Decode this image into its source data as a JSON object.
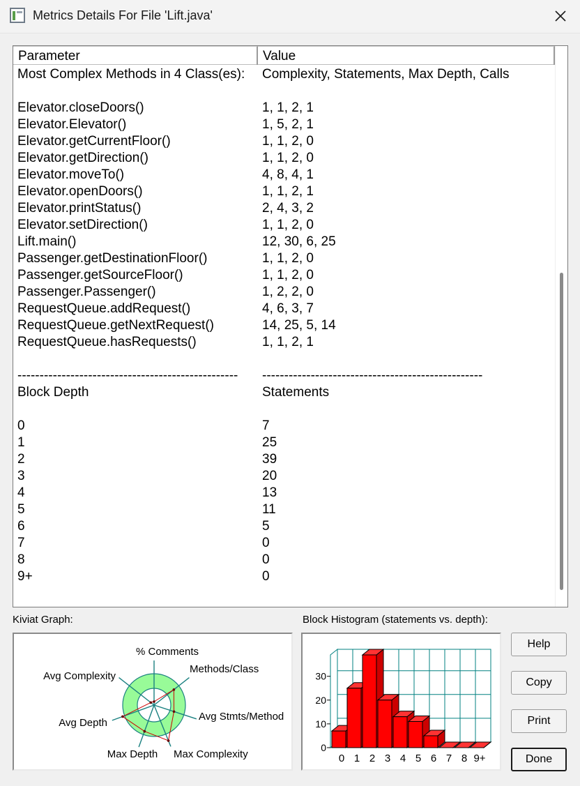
{
  "window": {
    "title": "Metrics Details For File 'Lift.java'"
  },
  "table": {
    "header": {
      "parameter": "Parameter",
      "value": "Value"
    },
    "rows": [
      [
        "Most Complex Methods in 4 Class(es):",
        "Complexity, Statements, Max Depth, Calls"
      ],
      [
        "",
        ""
      ],
      [
        "Elevator.closeDoors()",
        "1, 1, 2, 1"
      ],
      [
        "Elevator.Elevator()",
        "1, 5, 2, 1"
      ],
      [
        "Elevator.getCurrentFloor()",
        "1, 1, 2, 0"
      ],
      [
        "Elevator.getDirection()",
        "1, 1, 2, 0"
      ],
      [
        "Elevator.moveTo()",
        "4, 8, 4, 1"
      ],
      [
        "Elevator.openDoors()",
        "1, 1, 2, 1"
      ],
      [
        "Elevator.printStatus()",
        "2, 4, 3, 2"
      ],
      [
        "Elevator.setDirection()",
        "1, 1, 2, 0"
      ],
      [
        "Lift.main()",
        "12, 30, 6, 25"
      ],
      [
        "Passenger.getDestinationFloor()",
        "1, 1, 2, 0"
      ],
      [
        "Passenger.getSourceFloor()",
        "1, 1, 2, 0"
      ],
      [
        "Passenger.Passenger()",
        "1, 2, 2, 0"
      ],
      [
        "RequestQueue.addRequest()",
        "4, 6, 3, 7"
      ],
      [
        "RequestQueue.getNextRequest()",
        "14, 25, 5, 14"
      ],
      [
        "RequestQueue.hasRequests()",
        "1, 1, 2, 1"
      ],
      [
        "",
        ""
      ],
      [
        "--------------------------------------------------",
        "--------------------------------------------------"
      ],
      [
        "Block Depth",
        "Statements"
      ],
      [
        "",
        ""
      ],
      [
        "0",
        "7"
      ],
      [
        "1",
        "25"
      ],
      [
        "2",
        "39"
      ],
      [
        "3",
        "20"
      ],
      [
        "4",
        "13"
      ],
      [
        "5",
        "11"
      ],
      [
        "6",
        "5"
      ],
      [
        "7",
        "0"
      ],
      [
        "8",
        "0"
      ],
      [
        "9+",
        "0"
      ],
      [
        "",
        ""
      ],
      [
        "--------------------------------------------------",
        "--------------------------------------------------"
      ]
    ]
  },
  "kiviat": {
    "label": "Kiviat Graph:",
    "axes": [
      "% Comments",
      "Methods/Class",
      "Avg Stmts/Method",
      "Max Complexity",
      "Max Depth",
      "Avg Depth",
      "Avg Complexity"
    ]
  },
  "histogram": {
    "label": "Block Histogram (statements vs. depth):",
    "bar_color": "#ff0000",
    "grid_color": "#008080"
  },
  "chart_data": {
    "type": "bar",
    "categories": [
      "0",
      "1",
      "2",
      "3",
      "4",
      "5",
      "6",
      "7",
      "8",
      "9+"
    ],
    "values": [
      7,
      25,
      39,
      20,
      13,
      11,
      5,
      0,
      0,
      0
    ],
    "yticks": [
      "0",
      "10",
      "20",
      "30"
    ],
    "ylim": [
      0,
      39
    ]
  },
  "buttons": {
    "help": "Help",
    "copy": "Copy",
    "print": "Print",
    "done": "Done"
  }
}
